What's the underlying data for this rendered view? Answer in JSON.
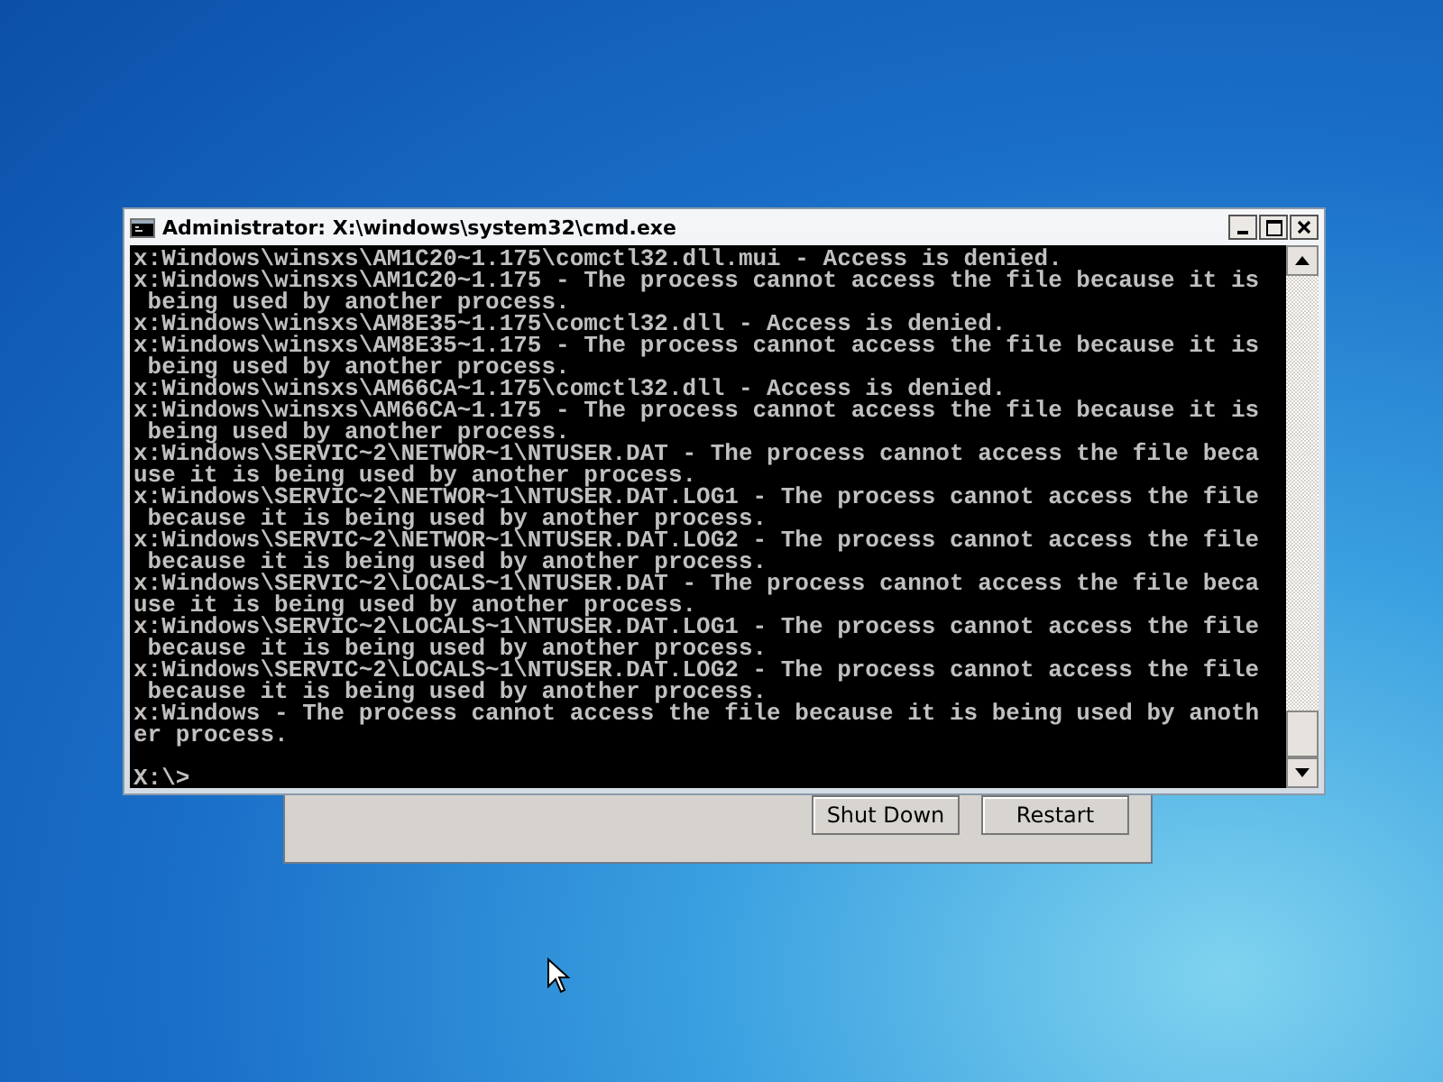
{
  "window": {
    "title": "Administrator: X:\\windows\\system32\\cmd.exe"
  },
  "console": {
    "lines": [
      "x:Windows\\winsxs\\AM1C20~1.175\\comctl32.dll.mui - Access is denied.",
      "x:Windows\\winsxs\\AM1C20~1.175 - The process cannot access the file because it is",
      " being used by another process.",
      "x:Windows\\winsxs\\AM8E35~1.175\\comctl32.dll - Access is denied.",
      "x:Windows\\winsxs\\AM8E35~1.175 - The process cannot access the file because it is",
      " being used by another process.",
      "x:Windows\\winsxs\\AM66CA~1.175\\comctl32.dll - Access is denied.",
      "x:Windows\\winsxs\\AM66CA~1.175 - The process cannot access the file because it is",
      " being used by another process.",
      "x:Windows\\SERVIC~2\\NETWOR~1\\NTUSER.DAT - The process cannot access the file beca",
      "use it is being used by another process.",
      "x:Windows\\SERVIC~2\\NETWOR~1\\NTUSER.DAT.LOG1 - The process cannot access the file",
      " because it is being used by another process.",
      "x:Windows\\SERVIC~2\\NETWOR~1\\NTUSER.DAT.LOG2 - The process cannot access the file",
      " because it is being used by another process.",
      "x:Windows\\SERVIC~2\\LOCALS~1\\NTUSER.DAT - The process cannot access the file beca",
      "use it is being used by another process.",
      "x:Windows\\SERVIC~2\\LOCALS~1\\NTUSER.DAT.LOG1 - The process cannot access the file",
      " because it is being used by another process.",
      "x:Windows\\SERVIC~2\\LOCALS~1\\NTUSER.DAT.LOG2 - The process cannot access the file",
      " because it is being used by another process.",
      "x:Windows - The process cannot access the file because it is being used by anoth",
      "er process."
    ],
    "prompt": "X:\\>"
  },
  "dialog": {
    "buttons": [
      "Shut Down",
      "Restart"
    ]
  }
}
